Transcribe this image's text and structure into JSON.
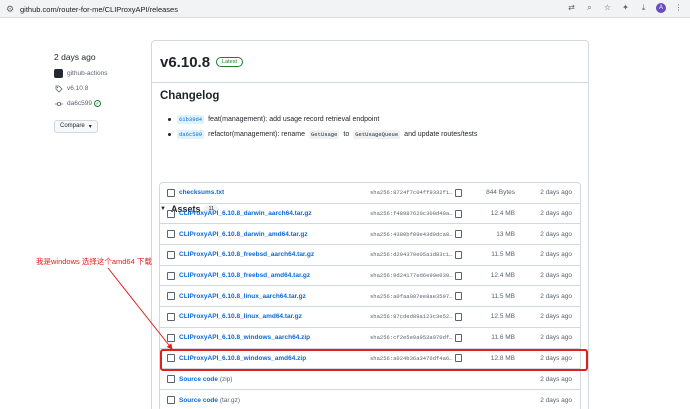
{
  "browser": {
    "url": "github.com/router-for-me/CLIProxyAPI/releases",
    "profile_initial": "A"
  },
  "meta": {
    "date": "2 days ago",
    "author": "github-actions",
    "tag": "v6.10.8",
    "commit": "da6c599",
    "compare_label": "Compare"
  },
  "release": {
    "title": "v6.10.8",
    "badge": "Latest",
    "changelog_title": "Changelog",
    "changes": [
      {
        "sha": "61b39d4",
        "text_before": "feat(management): add usage record retrieval endpoint",
        "code1": "",
        "mid": "",
        "code2": "",
        "text_after": ""
      },
      {
        "sha": "da6c599",
        "text_before": "refactor(management): rename",
        "code1": "GetUsage",
        "mid": "to",
        "code2": "GetUsageQueue",
        "text_after": "and update routes/tests"
      }
    ]
  },
  "assets": {
    "title": "Assets",
    "count": "11",
    "rows": [
      {
        "name": "checksums.txt",
        "sha": "sha256:8724f7c04ff9332f1…",
        "size": "844 Bytes",
        "date": "2 days ago"
      },
      {
        "name": "CLIProxyAPI_6.10.8_darwin_aarch64.tar.gz",
        "sha": "sha256:f48987620c300d40a…",
        "size": "12.4 MB",
        "date": "2 days ago"
      },
      {
        "name": "CLIProxyAPI_6.10.8_darwin_amd64.tar.gz",
        "sha": "sha256:4380bf09e43d0dca0…",
        "size": "13 MB",
        "date": "2 days ago"
      },
      {
        "name": "CLIProxyAPI_6.10.8_freebsd_aarch64.tar.gz",
        "sha": "sha256:d204370e05a1d83c1…",
        "size": "11.5 MB",
        "date": "2 days ago"
      },
      {
        "name": "CLIProxyAPI_6.10.8_freebsd_amd64.tar.gz",
        "sha": "sha256:9d24177ed6e99e039…",
        "size": "12.4 MB",
        "date": "2 days ago"
      },
      {
        "name": "CLIProxyAPI_6.10.8_linux_aarch64.tar.gz",
        "sha": "sha256:a0faa087ee8ae3597…",
        "size": "11.5 MB",
        "date": "2 days ago"
      },
      {
        "name": "CLIProxyAPI_6.10.8_linux_amd64.tar.gz",
        "sha": "sha256:87cded89a123c3e52…",
        "size": "12.5 MB",
        "date": "2 days ago"
      },
      {
        "name": "CLIProxyAPI_6.10.8_windows_aarch64.zip",
        "sha": "sha256:cf2e5e0a953a970df…",
        "size": "11.6 MB",
        "date": "2 days ago"
      },
      {
        "name": "CLIProxyAPI_6.10.8_windows_amd64.zip",
        "sha": "sha256:a024b36a3476df4a6…",
        "size": "12.8 MB",
        "date": "2 days ago"
      },
      {
        "name": "Source code",
        "paren": "(zip)",
        "sha": "",
        "size": "",
        "date": "2 days ago"
      },
      {
        "name": "Source code",
        "paren": "(tar.gz)",
        "sha": "",
        "size": "",
        "date": "2 days ago"
      }
    ]
  },
  "annotation": {
    "text": "我是windows 选择这个amd64 下载",
    "color": "#e0211b"
  }
}
